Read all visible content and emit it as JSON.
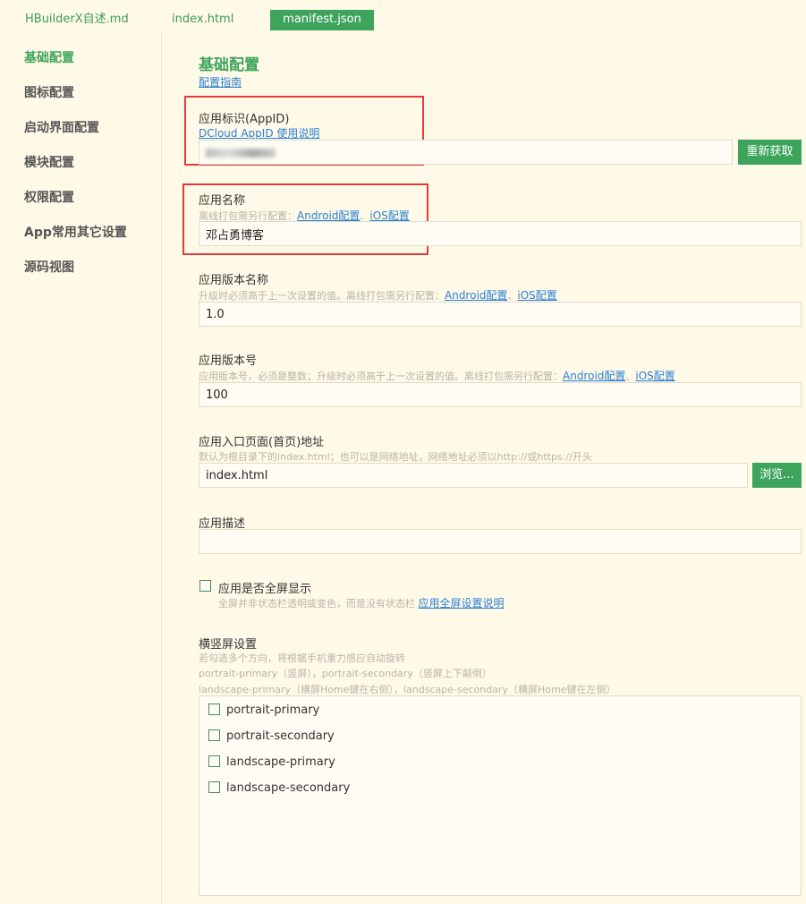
{
  "tabs": [
    {
      "label": "HBuilderX自述.md",
      "active": false
    },
    {
      "label": "index.html",
      "active": false
    },
    {
      "label": "manifest.json",
      "active": true
    }
  ],
  "sidebar": {
    "items": [
      {
        "label": "基础配置",
        "active": true
      },
      {
        "label": "图标配置"
      },
      {
        "label": "启动界面配置"
      },
      {
        "label": "模块配置"
      },
      {
        "label": "权限配置"
      },
      {
        "label": "App常用其它设置"
      },
      {
        "label": "源码视图"
      }
    ]
  },
  "main": {
    "title": "基础配置",
    "guide_link": "配置指南",
    "appid": {
      "label": "应用标识(AppID)",
      "link": "DCloud AppID 使用说明",
      "button": "重新获取"
    },
    "appname": {
      "label": "应用名称",
      "hint": "离线打包需另行配置：",
      "link_android": "Android配置",
      "sep": "、",
      "link_ios": "iOS配置",
      "value": "邓占勇博客"
    },
    "version_name": {
      "label": "应用版本名称",
      "hint": "升级时必须高于上一次设置的值。离线打包需另行配置：",
      "link_android": "Android配置",
      "sep": "、",
      "link_ios": "iOS配置",
      "value": "1.0"
    },
    "version_code": {
      "label": "应用版本号",
      "hint": "应用版本号，必须是整数；升级时必须高于上一次设置的值。离线打包需另行配置：",
      "link_android": "Android配置",
      "sep": "、",
      "link_ios": "iOS配置",
      "value": "100"
    },
    "entry": {
      "label": "应用入口页面(首页)地址",
      "hint": "默认为根目录下的index.html；也可以是网络地址，网络地址必须以http://或https://开头",
      "value": "index.html",
      "button": "浏览..."
    },
    "description": {
      "label": "应用描述",
      "value": ""
    },
    "fullscreen": {
      "label": "应用是否全屏显示",
      "hint": "全屏并非状态栏透明或变色，而是没有状态栏",
      "link": "应用全屏设置说明",
      "checked": false
    },
    "orientation": {
      "label": "横竖屏设置",
      "hint1": "若勾选多个方向，将根据手机重力感应自动旋转",
      "hint2": "portrait-primary（竖屏），portrait-secondary（竖屏上下颠倒）",
      "hint3": "landscape-primary（横屏Home键在右侧），landscape-secondary（横屏Home键在左侧）",
      "options": [
        {
          "label": "portrait-primary",
          "checked": false
        },
        {
          "label": "portrait-secondary",
          "checked": false
        },
        {
          "label": "landscape-primary",
          "checked": false
        },
        {
          "label": "landscape-secondary",
          "checked": false
        }
      ]
    }
  },
  "colors": {
    "accent": "#3ea45c",
    "background": "#fffae8",
    "link": "#2a7fd4",
    "highlight": "#e53a3a"
  }
}
